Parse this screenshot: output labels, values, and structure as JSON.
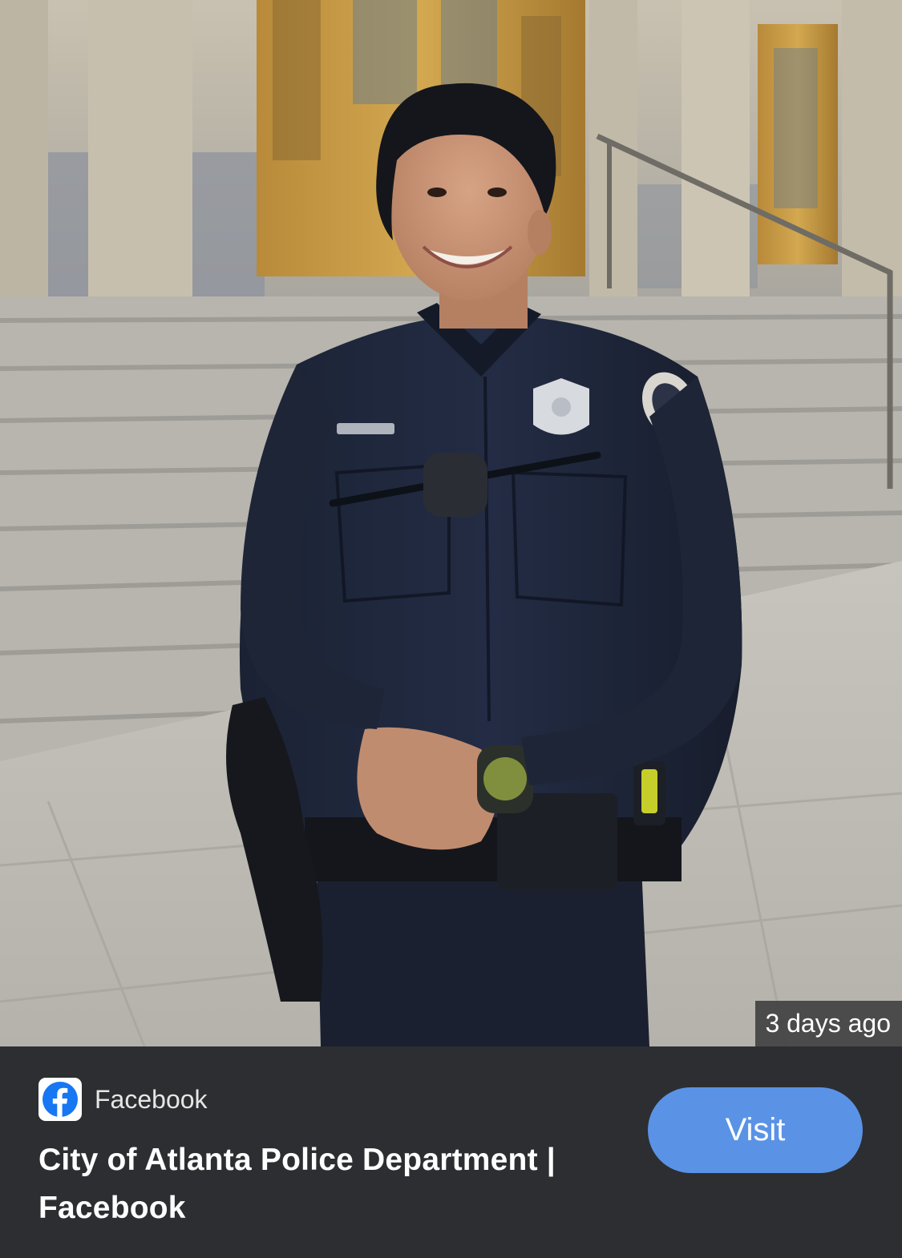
{
  "image_result": {
    "photo_alt": "Smiling police officer in dark navy uniform standing in front of building steps",
    "timestamp": "3 days ago"
  },
  "source": {
    "icon": "facebook-icon",
    "name": "Facebook",
    "brand_color": "#1877f2"
  },
  "result": {
    "title": "City of Atlanta Police Department | Facebook"
  },
  "actions": {
    "visit_label": "Visit"
  },
  "colors": {
    "panel_background": "#2d2e31",
    "button_background": "#5a93e6",
    "text_primary": "#ffffff"
  }
}
